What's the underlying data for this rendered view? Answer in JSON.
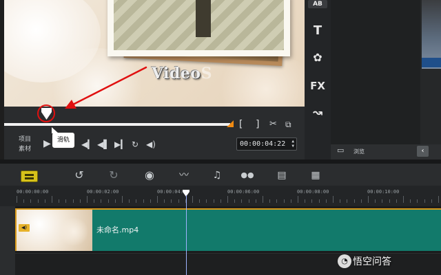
{
  "preview": {
    "title_main": "Video",
    "title_tail": "S"
  },
  "player": {
    "tooltip": "滑轨",
    "mode_project": "项目",
    "mode_clip": "素材",
    "mark_in": "[",
    "mark_out": "]",
    "timecode": "00:00:04:22"
  },
  "tools": {
    "items": [
      {
        "name": "ab-icon",
        "glyph": "AB"
      },
      {
        "name": "title-icon",
        "glyph": "T"
      },
      {
        "name": "graphics-icon",
        "glyph": "✿"
      },
      {
        "name": "fx-icon",
        "glyph": "FX"
      },
      {
        "name": "path-icon",
        "glyph": "↝"
      }
    ]
  },
  "library": {
    "browse_label": "浏览",
    "prev_button": "‹"
  },
  "timeline": {
    "ruler_labels": [
      "00:00:00:00",
      "00:00:02:00",
      "00:00:04:00",
      "00:00:06:00",
      "00:00:08:00",
      "00:00:10:00"
    ],
    "clip_name": "未命名.mp4",
    "clip_audio_badge": "◀)"
  },
  "toolbar_icons": [
    {
      "name": "undo-icon",
      "glyph": "↺"
    },
    {
      "name": "redo-icon",
      "glyph": "↻"
    },
    {
      "name": "record-capture-icon",
      "glyph": "◉"
    },
    {
      "name": "sound-mixer-icon",
      "glyph": "〰"
    },
    {
      "name": "auto-music-icon",
      "glyph": "♫"
    },
    {
      "name": "motion-tracking-icon",
      "glyph": "●●"
    },
    {
      "name": "subtitle-editor-icon",
      "glyph": "▤"
    },
    {
      "name": "multi-camera-icon",
      "glyph": "▦"
    }
  ],
  "watermark": {
    "text": "悟空问答"
  },
  "colors": {
    "clip_fill": "#127a6b",
    "annotation_red": "#e01010",
    "accent_orange": "#f08a12",
    "storyboard_yellow": "#d7c21a"
  }
}
